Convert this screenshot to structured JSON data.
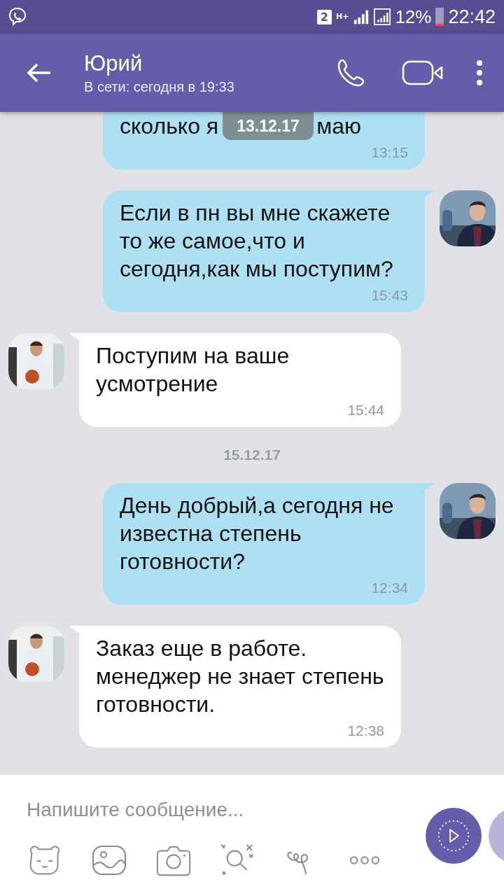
{
  "status_bar": {
    "sim": "2",
    "network": "H+",
    "battery_text": "12%",
    "time": "22:42"
  },
  "header": {
    "title": "Юрий",
    "subtitle": "В сети: сегодня в 19:33"
  },
  "sticky_date": "13.12.17",
  "messages": [
    {
      "kind": "outgoing",
      "text_parts": [
        "сколько я",
        "маю"
      ],
      "time": "13:15",
      "cut": true
    },
    {
      "kind": "outgoing",
      "text": "Если в пн вы мне скажете то же самое,что и сегодня,как мы поступим?",
      "time": "15:43"
    },
    {
      "kind": "incoming",
      "text": "Поступим на ваше усмотрение",
      "time": "15:44"
    },
    {
      "kind": "date",
      "text": "15.12.17"
    },
    {
      "kind": "outgoing",
      "text": "День добрый,а сегодня не известна степень готовности?",
      "time": "12:34"
    },
    {
      "kind": "incoming",
      "text": "Заказ еще в работе. менеджер не знает степень готовности.",
      "time": "12:38"
    }
  ],
  "composer": {
    "placeholder": "Напишите сообщение..."
  }
}
